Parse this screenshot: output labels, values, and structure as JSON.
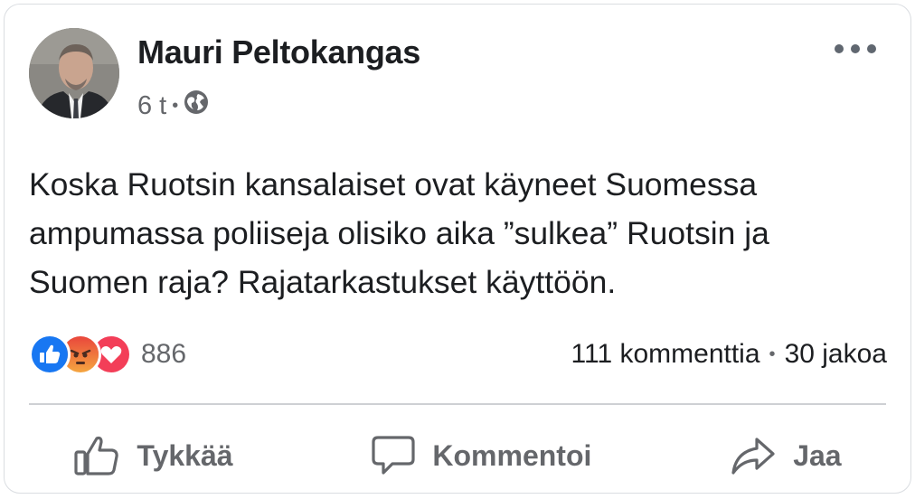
{
  "post": {
    "author": "Mauri Peltokangas",
    "time": "6 t",
    "audience_icon": "globe-icon",
    "text": "Koska Ruotsin kansalaiset ovat käyneet Suomessa ampumassa poliiseja olisiko aika ”sulkea” Ruotsin ja Suomen raja? Rajatarkastukset käyttöön."
  },
  "reactions": {
    "icons": [
      "like-icon",
      "angry-icon",
      "love-icon"
    ],
    "count": "886",
    "comments": "111 kommenttia",
    "shares": "30 jakoa"
  },
  "actions": {
    "like": "Tykkää",
    "comment": "Kommentoi",
    "share": "Jaa"
  },
  "colors": {
    "like_blue": "#1877f2",
    "angry_orange": "#f7714c",
    "love_red": "#f33e58",
    "secondary_text": "#65676b"
  }
}
